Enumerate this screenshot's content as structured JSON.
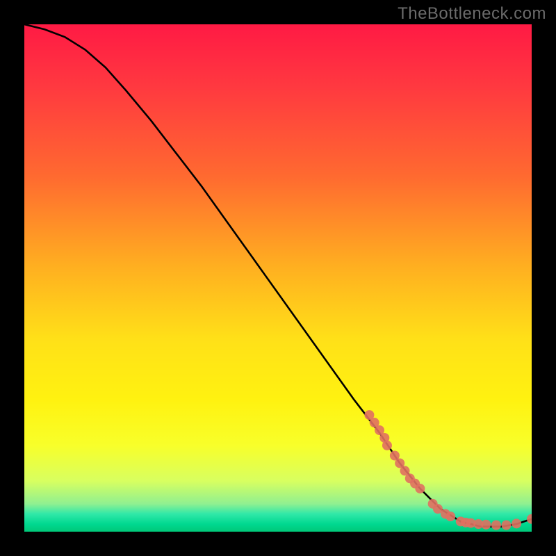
{
  "watermark": "TheBottleneck.com",
  "chart_data": {
    "type": "line",
    "title": "",
    "xlabel": "",
    "ylabel": "",
    "xlim": [
      0,
      100
    ],
    "ylim": [
      0,
      100
    ],
    "legend": false,
    "background_gradient": {
      "stops": [
        {
          "offset": 0.0,
          "color": "#ff1a44"
        },
        {
          "offset": 0.12,
          "color": "#ff3840"
        },
        {
          "offset": 0.3,
          "color": "#ff6a30"
        },
        {
          "offset": 0.48,
          "color": "#ffb020"
        },
        {
          "offset": 0.62,
          "color": "#ffe018"
        },
        {
          "offset": 0.74,
          "color": "#fff210"
        },
        {
          "offset": 0.83,
          "color": "#f8ff2a"
        },
        {
          "offset": 0.9,
          "color": "#d8ff60"
        },
        {
          "offset": 0.945,
          "color": "#90f090"
        },
        {
          "offset": 0.965,
          "color": "#30e8a8"
        },
        {
          "offset": 0.985,
          "color": "#00d890"
        },
        {
          "offset": 1.0,
          "color": "#00c878"
        }
      ]
    },
    "series": [
      {
        "name": "curve",
        "type": "line",
        "color": "#000000",
        "x": [
          0,
          4,
          8,
          12,
          16,
          20,
          25,
          30,
          35,
          40,
          45,
          50,
          55,
          60,
          65,
          70,
          74,
          78,
          82,
          86,
          90,
          94,
          97,
          100
        ],
        "y": [
          100,
          99,
          97.5,
          95,
          91.5,
          87,
          81,
          74.5,
          68,
          61,
          54,
          47,
          40,
          33,
          26,
          19.5,
          13.5,
          8.5,
          4.5,
          2.0,
          1.0,
          1.0,
          1.5,
          2.5
        ]
      },
      {
        "name": "overlay-dots",
        "type": "scatter",
        "color": "#e07060",
        "x": [
          68,
          69,
          70,
          71,
          71.5,
          73,
          74,
          75,
          76,
          77,
          78,
          80.5,
          81.5,
          83,
          84,
          86,
          87,
          88,
          89.5,
          91,
          93,
          95,
          97,
          100
        ],
        "y": [
          23,
          21.5,
          20,
          18.5,
          17,
          15,
          13.5,
          12,
          10.5,
          9.5,
          8.5,
          5.5,
          4.5,
          3.5,
          3.0,
          2.0,
          1.8,
          1.7,
          1.5,
          1.4,
          1.3,
          1.3,
          1.6,
          2.5
        ]
      }
    ]
  }
}
